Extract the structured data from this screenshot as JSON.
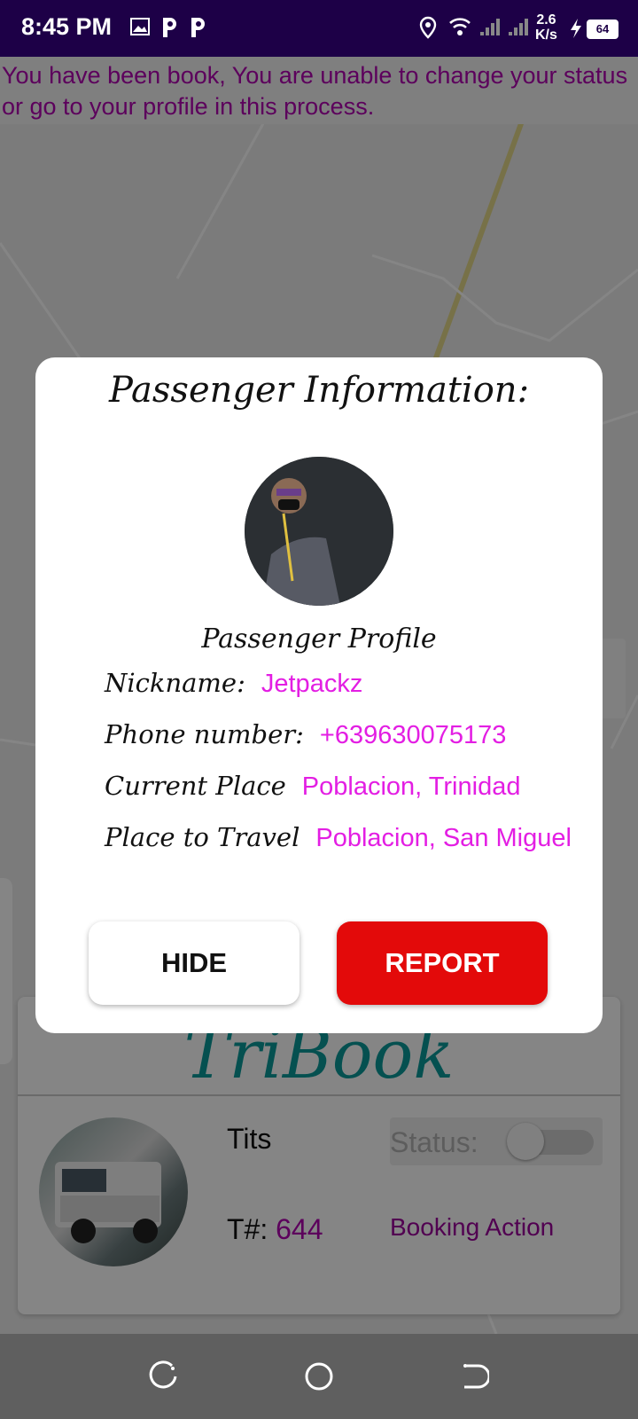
{
  "status_bar": {
    "time": "8:45 PM",
    "net_speed_value": "2.6",
    "net_speed_unit": "K/s",
    "battery": "64",
    "icons": [
      "image-icon",
      "p-app-icon",
      "p-app-icon",
      "location-icon",
      "wifi-icon",
      "signal-icon",
      "signal-icon",
      "charging-icon",
      "battery-icon"
    ]
  },
  "banner": {
    "text": "You have been book, You are unable to change your status or go to your profile in this process."
  },
  "dialog": {
    "title": "Passenger Information:",
    "profile_caption": "Passenger Profile",
    "fields": [
      {
        "label": "Nickname:",
        "value": "Jetpackz"
      },
      {
        "label": "Phone number:",
        "value": "+639630075173"
      },
      {
        "label": "Current Place",
        "value": "Poblacion, Trinidad"
      },
      {
        "label": "Place to Travel",
        "value": "Poblacion, San Miguel"
      }
    ],
    "hide_label": "HIDE",
    "report_label": "REPORT"
  },
  "card": {
    "brand": "TriBook",
    "driver_name": "Tits",
    "status_label": "Status:",
    "tnum_label": "T#:",
    "tnum_value": "644",
    "booking_action": "Booking Action"
  },
  "colors": {
    "status_bar_bg": "#1d0047",
    "value_magenta": "#e31ee3",
    "banner_text": "#b000b0",
    "report_red": "#e30a0a",
    "brand_teal": "#0a9a9a"
  }
}
